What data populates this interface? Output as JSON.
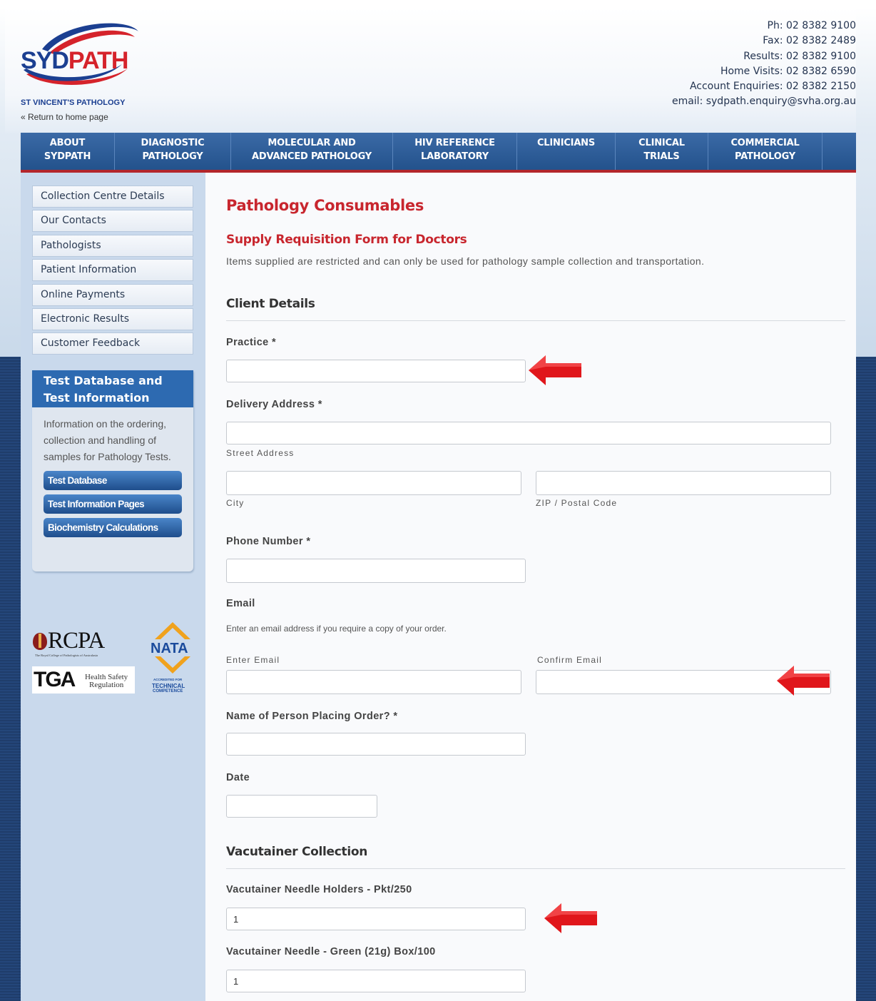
{
  "header": {
    "logo_main_1": "SYD",
    "logo_main_2": "PATH",
    "logo_sub": "ST VINCENT'S PATHOLOGY",
    "return_link": "« Return to home page",
    "contact": [
      "Ph: 02 8382 9100",
      "Fax: 02 8382 2489",
      "Results: 02 8382 9100",
      "Home Visits: 02 8382 6590",
      "Account Enquiries: 02 8382 2150",
      "email: sydpath.enquiry@svha.org.au"
    ]
  },
  "nav": [
    {
      "line1": "ABOUT",
      "line2": "SYDPATH"
    },
    {
      "line1": "DIAGNOSTIC",
      "line2": "PATHOLOGY"
    },
    {
      "line1": "MOLECULAR AND",
      "line2": "ADVANCED PATHOLOGY"
    },
    {
      "line1": "HIV REFERENCE",
      "line2": "LABORATORY"
    },
    {
      "line1": "CLINICIANS",
      "line2": ""
    },
    {
      "line1": "CLINICAL",
      "line2": "TRIALS"
    },
    {
      "line1": "COMMERCIAL",
      "line2": "PATHOLOGY"
    }
  ],
  "sidebar": {
    "items": [
      "Collection Centre Details",
      "Our Contacts",
      "Pathologists",
      "Patient Information",
      "Online Payments",
      "Electronic Results",
      "Customer Feedback"
    ],
    "info_box": {
      "title": "Test Database and Test Information",
      "text": "Information on the ordering, collection and handling of samples for Pathology Tests.",
      "buttons": [
        "Test Database",
        "Test Information Pages",
        "Biochemistry Calculations"
      ]
    },
    "badges": {
      "rcpa": "RCPA",
      "rcpa_sub": "The Royal College of Pathologists of Australasia",
      "nata": "NATA",
      "nata_sub1": "ACCREDITED FOR",
      "nata_sub2": "TECHNICAL",
      "nata_sub3": "COMPETENCE",
      "tga": "TGA",
      "tga_sub1": "Health Safety",
      "tga_sub2": "Regulation"
    }
  },
  "main": {
    "title": "Pathology Consumables",
    "subtitle": "Supply Requisition Form for Doctors",
    "intro": "Items supplied are restricted and can only be used for pathology sample collection and transportation.",
    "client_section": "Client Details",
    "practice_label": "Practice *",
    "practice_value": "",
    "delivery_label": "Delivery Address *",
    "street_sub": "Street Address",
    "city_sub": "City",
    "zip_sub": "ZIP / Postal Code",
    "phone_label": "Phone Number *",
    "email_label": "Email",
    "email_hint": "Enter an email address if you require a copy of your order.",
    "enter_email_sub": "Enter Email",
    "confirm_email_sub": "Confirm Email",
    "name_label": "Name of Person Placing Order? *",
    "date_label": "Date",
    "vac_section": "Vacutainer Collection",
    "holders_label": "Vacutainer Needle Holders - Pkt/250",
    "holders_value": "1",
    "needle_label": "Vacutainer Needle - Green (21g) Box/100",
    "needle_value": "1"
  },
  "colors": {
    "brand_red": "#c8262e",
    "brand_blue": "#1b3f91",
    "nav_blue": "#2d5f9e",
    "arrow_red": "#e0161b"
  }
}
